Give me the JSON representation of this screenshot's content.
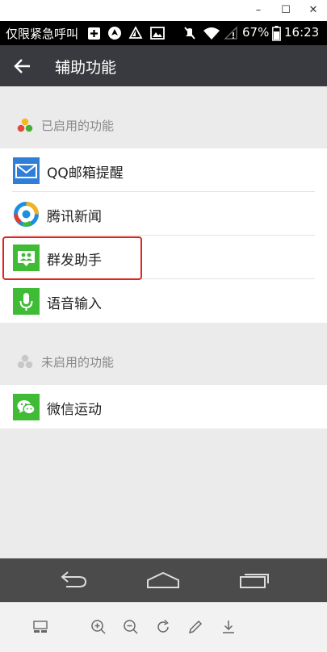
{
  "window": {
    "minimize_glyph": "–",
    "maximize_glyph": "☐",
    "close_glyph": "✕"
  },
  "status_bar": {
    "carrier": "仅限紧急呼叫",
    "battery": "67%",
    "time": "16:23",
    "icons": [
      "add-box-icon",
      "navigation-icon",
      "warning-sail-icon",
      "image-icon",
      "mute-icon",
      "wifi-icon",
      "no-signal-icon",
      "battery-icon"
    ]
  },
  "toolbar": {
    "title": "辅助功能",
    "back_icon": "back-arrow-icon"
  },
  "enabled_section": {
    "title": "已启用的功能",
    "items": [
      {
        "label": "QQ邮箱提醒",
        "icon": "qq-mail-icon",
        "color": "#2f7fd8"
      },
      {
        "label": "腾讯新闻",
        "icon": "tencent-news-icon",
        "color": "#1d8fe0"
      },
      {
        "label": "群发助手",
        "icon": "mass-send-icon",
        "color": "#3fbb35"
      },
      {
        "label": "语音输入",
        "icon": "voice-input-icon",
        "color": "#3fbb35"
      }
    ]
  },
  "disabled_section": {
    "title": "未启用的功能",
    "items": [
      {
        "label": "微信运动",
        "icon": "wechat-sport-icon",
        "color": "#3fbb35"
      }
    ]
  },
  "colors": {
    "toolbar_bg": "#393a3f",
    "page_bg": "#ebebeb",
    "highlight": "#e0231c"
  }
}
